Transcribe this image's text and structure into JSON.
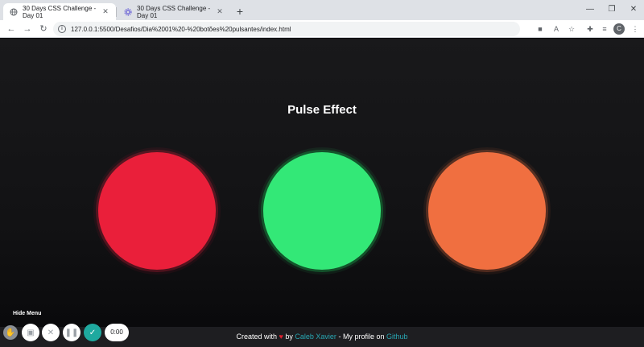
{
  "browser": {
    "tabs": [
      {
        "title": "30 Days CSS Challenge - Day 01",
        "active": true,
        "icon": "globe-icon"
      },
      {
        "title": "30 Days CSS Challenge - Day 01",
        "active": false,
        "icon": "gear-icon"
      }
    ],
    "url": "127.0.0.1:5500/Desafios/Dia%2001%20-%20botões%20pulsantes/index.html",
    "profile_initial": "C"
  },
  "page": {
    "title": "Pulse Effect",
    "buttons": [
      {
        "name": "red",
        "color": "#ea1f3a"
      },
      {
        "name": "green",
        "color": "#33e877"
      },
      {
        "name": "orange",
        "color": "#f06f40"
      }
    ],
    "footer": {
      "created_with": "Created with",
      "by": "by",
      "author": "Caleb Xavier",
      "profile_text": "- My profile on",
      "github": "Github"
    }
  },
  "recorder": {
    "hide_menu_label": "Hide Menu",
    "timer": "0:00",
    "accent": "#1fa99f"
  }
}
